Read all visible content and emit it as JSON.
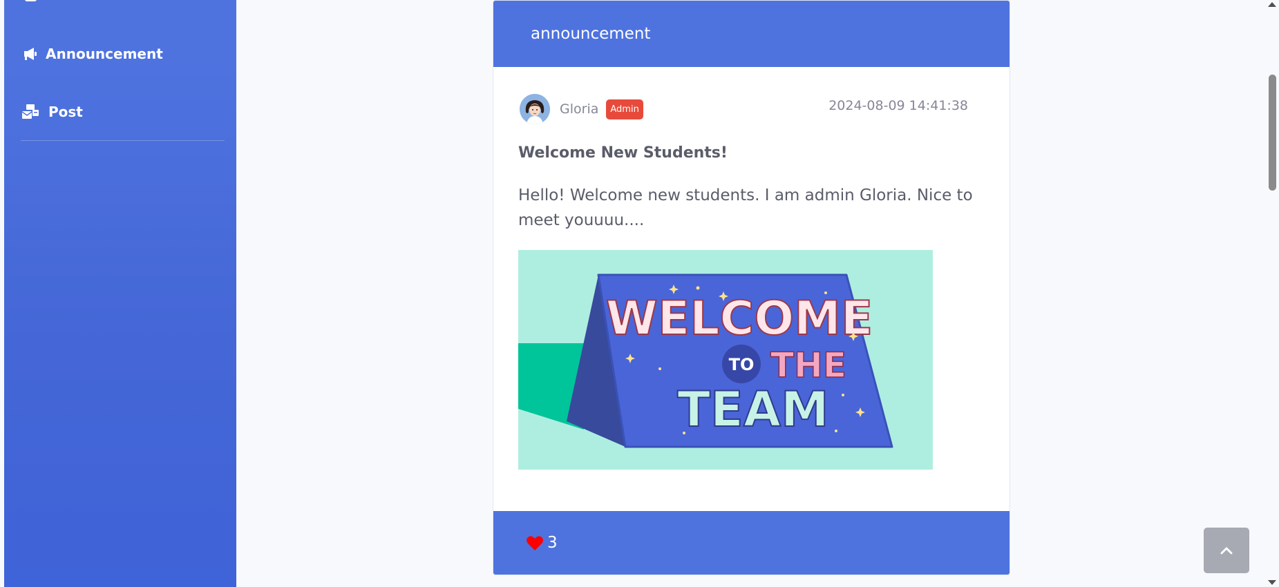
{
  "sidebar": {
    "items": [
      {
        "label": "Announcement",
        "icon": "megaphone-icon"
      },
      {
        "label": "Post",
        "icon": "mail-bulk-icon"
      }
    ]
  },
  "card": {
    "header_title": "announcement",
    "author": {
      "name": "Gloria",
      "role": "Admin",
      "avatar": "avatar-icon"
    },
    "timestamp": "2024-08-09 14:41:38",
    "post_title": "Welcome New Students!",
    "post_content": "Hello! Welcome new students. I am admin Gloria. Nice to meet youuuu....",
    "image": {
      "lettering": "WELCOME TO THE TEAM"
    },
    "footer": {
      "likes": "3",
      "like_icon": "heart-icon"
    }
  },
  "scroll_top_icon": "chevron-up-icon",
  "colors": {
    "primary": "#4e73df",
    "badge": "#e74a3b",
    "like": "#ff0000",
    "text_muted": "#858796",
    "text_body": "#5a5c69"
  }
}
